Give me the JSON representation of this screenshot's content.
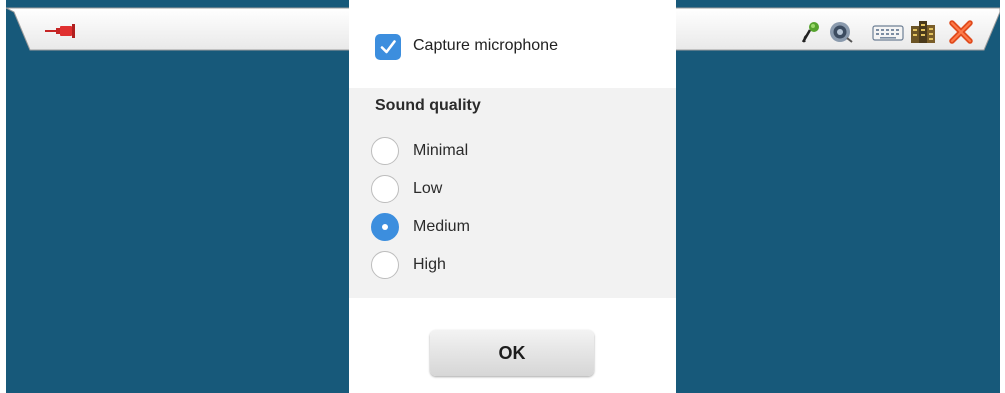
{
  "toolbar": {
    "left_icons": [
      "pushpin-icon"
    ],
    "right_icons": [
      "microphone-icon",
      "speaker-icon",
      "keyboard-icon",
      "building-icon",
      "close-icon"
    ],
    "background": "#ffffff",
    "close_color": "#e04a1c"
  },
  "dialog": {
    "capture_microphone": {
      "label": "Capture microphone",
      "checked": true
    },
    "sound_quality": {
      "heading": "Sound quality",
      "options": [
        {
          "label": "Minimal",
          "selected": false
        },
        {
          "label": "Low",
          "selected": false
        },
        {
          "label": "Medium",
          "selected": true
        },
        {
          "label": "High",
          "selected": false
        }
      ]
    },
    "ok_label": "OK"
  },
  "colors": {
    "desktop": "#17597a",
    "accent": "#3c8ede",
    "section_bg": "#f2f2f2"
  }
}
